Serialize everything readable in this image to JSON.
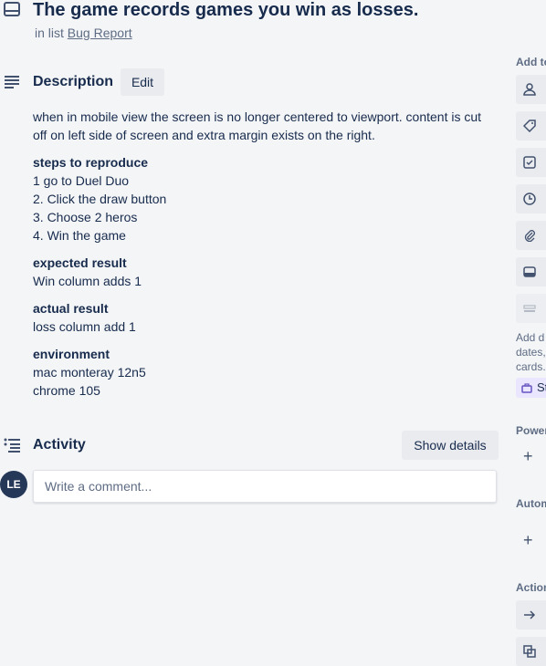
{
  "card": {
    "title": "The game records games you win as losses.",
    "in_list_prefix": "in list",
    "list_name": "Bug Report"
  },
  "description": {
    "heading": "Description",
    "edit_label": "Edit",
    "intro": "when in mobile view the screen is no longer centered to viewport. content is cut off on left side of screen and extra margin exists on the right.",
    "steps_heading": "steps to reproduce",
    "steps": [
      "1 go to Duel Duo",
      "2. Click the draw button",
      "3. Choose 2 heros",
      "4. Win the game"
    ],
    "expected_heading": "expected result",
    "expected": "Win column adds 1",
    "actual_heading": "actual result",
    "actual": "loss column add 1",
    "env_heading": "environment",
    "env": [
      "mac monteray 12n5",
      "chrome 105"
    ]
  },
  "activity": {
    "heading": "Activity",
    "show_details_label": "Show details",
    "avatar_initials": "LE",
    "comment_placeholder": "Write a comment..."
  },
  "sidebar": {
    "add_to_card": "Add to",
    "hint": "Add d dates, cards.",
    "hint_lines": [
      "Add d",
      "dates,",
      "cards."
    ],
    "badge_text": "St",
    "powerups": "Power",
    "automation": "Autom",
    "actions": "Action"
  }
}
